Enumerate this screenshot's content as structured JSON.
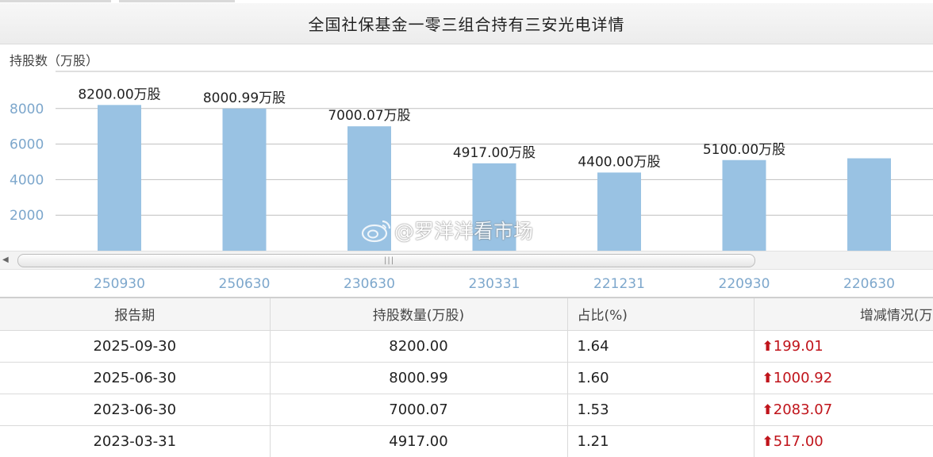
{
  "page": {
    "title": "全国社保基金一零三组合持有三安光电详情",
    "y_unit_label": "持股数（万股）",
    "watermark_text": "@罗洋洋看市场"
  },
  "colors": {
    "bar": "#99c2e3",
    "axis_label": "#7da7cc",
    "increase": "#c0141b",
    "grid": "#bfbfbf"
  },
  "chart_data": {
    "type": "bar",
    "categories": [
      "250930",
      "250630",
      "230630",
      "230331",
      "221231",
      "220930",
      "220630"
    ],
    "values": [
      8200.0,
      8000.99,
      7000.07,
      4917.0,
      4400.0,
      5100.0,
      5200
    ],
    "data_labels": [
      "8200.00万股",
      "8000.99万股",
      "7000.07万股",
      "4917.00万股",
      "4400.00万股",
      "5100.00万股",
      ""
    ],
    "ylabel": "持股数（万股）",
    "yticks": [
      2000,
      4000,
      6000,
      8000
    ],
    "ylim": [
      0,
      10000
    ],
    "grid": true
  },
  "scrollbar": {
    "left_arrow": "◀",
    "grip": "|||"
  },
  "table": {
    "headers": [
      "报告期",
      "持股数量(万股)",
      "占比(%)",
      "增减情况(万"
    ],
    "rows": [
      {
        "period": "2025-09-30",
        "shares": "8200.00",
        "ratio": "1.64",
        "arrow": "🠅",
        "change": "199.01"
      },
      {
        "period": "2025-06-30",
        "shares": "8000.99",
        "ratio": "1.60",
        "arrow": "🠅",
        "change": "1000.92"
      },
      {
        "period": "2023-06-30",
        "shares": "7000.07",
        "ratio": "1.53",
        "arrow": "🠅",
        "change": "2083.07"
      },
      {
        "period": "2023-03-31",
        "shares": "4917.00",
        "ratio": "1.21",
        "arrow": "🠅",
        "change": "517.00"
      }
    ]
  }
}
